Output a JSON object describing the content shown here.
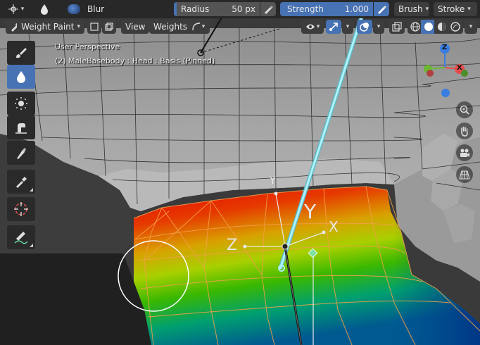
{
  "topbar": {
    "mode_icon": "editor-type-icon",
    "brush_icon": "blur-brush-icon",
    "brush_name": "Blur",
    "radius_label": "Radius",
    "radius_value": "50 px",
    "strength_label": "Strength",
    "strength_value": "1.000",
    "brush_menu": "Brush",
    "stroke_menu": "Stroke"
  },
  "header": {
    "mode_label": "Weight Paint",
    "view_menu": "View",
    "weights_menu": "Weights"
  },
  "overlay": {
    "perspective": "User Perspective",
    "object_info": "(2) MaleBasebody : Head : Basis (Pinned)"
  },
  "gizmo": {
    "x_label": "X",
    "y_label": "Y",
    "z_label": "Z",
    "axis_x_color": "#e84c4c",
    "axis_y_color": "#6bb832",
    "axis_z_color": "#3a7de0"
  },
  "bone_axes": {
    "y_label": "Y",
    "x_label": "X",
    "z_label": "Z",
    "y_big_label": "Y"
  },
  "toolbar": {
    "tools": [
      {
        "name": "draw-tool",
        "icon": "brush-icon",
        "active": false
      },
      {
        "name": "blur-tool",
        "icon": "drop-icon",
        "active": true
      },
      {
        "name": "average-tool",
        "icon": "average-icon",
        "active": false
      },
      {
        "name": "smear-tool",
        "icon": "smear-icon",
        "active": false
      },
      {
        "name": "gradient-tool",
        "icon": "gradient-icon",
        "active": false
      },
      {
        "name": "sample-weight-tool",
        "icon": "eyedropper-icon",
        "active": false
      },
      {
        "name": "cursor-tool",
        "icon": "cursor-icon",
        "active": false
      },
      {
        "name": "annotate-tool",
        "icon": "annotate-icon",
        "active": false
      }
    ]
  },
  "nav": {
    "zoom_icon": "zoom-icon",
    "pan_icon": "hand-icon",
    "camera_icon": "camera-icon",
    "ortho_icon": "grid-icon"
  },
  "colors": {
    "accent": "#4772b3",
    "bone_cyan": "#9ee7f0"
  }
}
